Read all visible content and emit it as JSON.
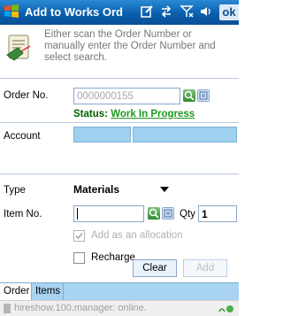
{
  "titlebar": {
    "title": "Add to Works Ord",
    "ok_label": "ok"
  },
  "info": {
    "text": "Either scan the Order Number or manually enter the Order Number and select search."
  },
  "order": {
    "label": "Order No.",
    "value": "0000000155",
    "status_label": "Status:",
    "status_value": "Work In Progress"
  },
  "account": {
    "label": "Account"
  },
  "type": {
    "label": "Type",
    "selected": "Materials"
  },
  "item": {
    "label": "Item No.",
    "qty_label": "Qty",
    "qty_value": "1"
  },
  "options": {
    "allocation_label": "Add as an allocation",
    "allocation_checked": true,
    "recharge_label": "Recharge",
    "recharge_checked": false
  },
  "buttons": {
    "clear": "Clear",
    "add": "Add"
  },
  "tabs": [
    {
      "label": "Order"
    },
    {
      "label": "Items"
    }
  ],
  "statusbar": {
    "text": "hireshow.100.manager: online."
  },
  "colors": {
    "titlebar": "#0a5fae",
    "field_blue": "#9fd0ef",
    "status_green": "#1e9a1e"
  }
}
